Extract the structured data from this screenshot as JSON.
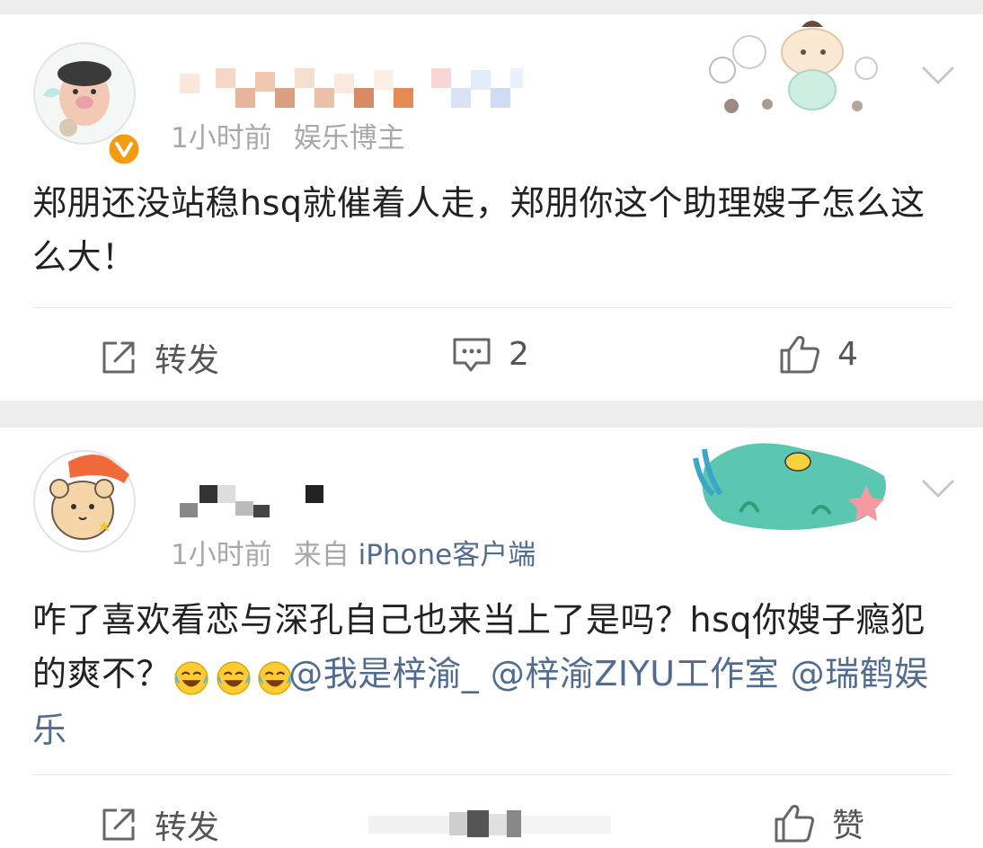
{
  "posts": [
    {
      "time": "1小时前",
      "source": "娱乐博主",
      "content": "郑朋还没站稳hsq就催着人走，郑朋你这个助理嫂子怎么这么大！",
      "actions": {
        "repost_label": "转发",
        "comment_count": "2",
        "like_count": "4"
      }
    },
    {
      "time": "1小时前",
      "source_prefix": "来自",
      "source": "iPhone客户端",
      "content_text": "咋了喜欢看恋与深孔自己也来当上了是吗？hsq你嫂子瘾犯的爽不？",
      "mentions": [
        "@我是梓渝_",
        "@梓渝ZIYU工作室",
        "@瑞鹤娱乐"
      ],
      "actions": {
        "repost_label": "转发",
        "like_label": "赞"
      }
    }
  ],
  "icons": [
    "repost-icon",
    "comment-icon",
    "like-icon",
    "chevron-down-icon",
    "verified-badge-icon",
    "laugh-cry-emoji-icon"
  ],
  "colors": {
    "link": "#516c90",
    "meta": "#a8a8a8",
    "text": "#222222",
    "verified": "#f39c12"
  }
}
